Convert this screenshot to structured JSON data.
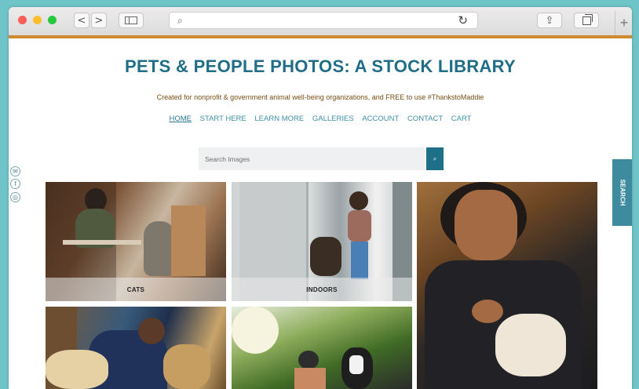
{
  "browser": {
    "back": "<",
    "forward": ">",
    "address_placeholder": "",
    "search_glyph": "⌕",
    "reload_glyph": "↻",
    "share_glyph": "⇪",
    "newtab_glyph": "+"
  },
  "site": {
    "title": "PETS & PEOPLE PHOTOS: A STOCK LIBRARY",
    "tagline": "Created for nonprofit & government animal well-being organizations, and FREE to use #ThankstoMaddie",
    "nav": [
      "HOME",
      "START HERE",
      "LEARN MORE",
      "GALLERIES",
      "ACCOUNT",
      "CONTACT",
      "CART"
    ],
    "search_placeholder": "Search Images",
    "search_button_glyph": "⌕",
    "side_search_label": "SEARCH",
    "social_icons": [
      "envelope-icon",
      "facebook-icon",
      "instagram-icon"
    ],
    "social_glyphs": [
      "✉",
      "f",
      "◎"
    ]
  },
  "gallery": {
    "tiles": [
      {
        "label": "CATS"
      },
      {
        "label": "INDOORS"
      }
    ]
  },
  "colors": {
    "page_bg": "#6fc4c7",
    "title": "#1f6d86",
    "accent_bar": "#d08a2e",
    "search_button": "#1e6f88",
    "side_tab": "#3e8b9f"
  }
}
